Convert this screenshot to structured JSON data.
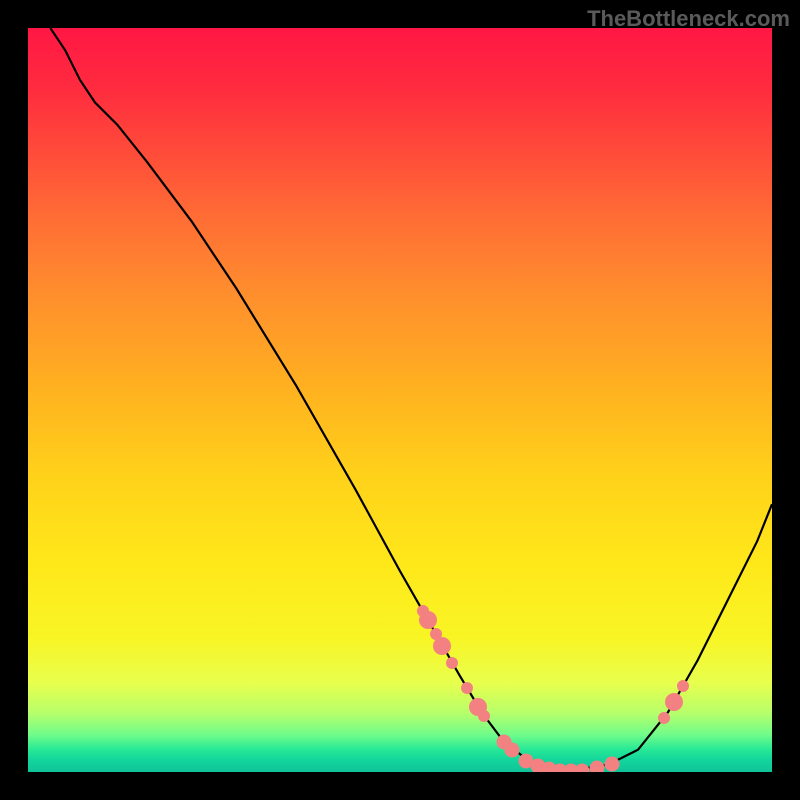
{
  "watermark": "TheBottleneck.com",
  "chart_data": {
    "type": "line",
    "title": "",
    "xlabel": "",
    "ylabel": "",
    "xlim": [
      0,
      100
    ],
    "ylim": [
      0,
      100
    ],
    "curve": {
      "x": [
        3,
        5,
        7,
        9,
        12,
        16,
        22,
        28,
        36,
        44,
        50,
        54,
        58,
        61,
        64,
        68,
        73,
        78,
        82,
        86,
        90,
        94,
        98,
        100
      ],
      "y": [
        100,
        97,
        93,
        90,
        87,
        82,
        74,
        65,
        52,
        38,
        27,
        20,
        13,
        8,
        4,
        1,
        0.2,
        1,
        3,
        8,
        15,
        23,
        31,
        36
      ]
    },
    "markers_on_curve": [
      {
        "x": 53.1,
        "y": 21.6,
        "r": 6
      },
      {
        "x": 53.8,
        "y": 20.4,
        "r": 9
      },
      {
        "x": 54.8,
        "y": 18.6,
        "r": 6
      },
      {
        "x": 55.7,
        "y": 17.0,
        "r": 9
      },
      {
        "x": 57.0,
        "y": 14.7,
        "r": 6
      },
      {
        "x": 59.0,
        "y": 11.3,
        "r": 6
      },
      {
        "x": 60.5,
        "y": 8.8,
        "r": 9
      },
      {
        "x": 61.3,
        "y": 7.5,
        "r": 6
      },
      {
        "x": 64.0,
        "y": 4.0,
        "r": 7.5
      },
      {
        "x": 65.0,
        "y": 3.0,
        "r": 7.5
      },
      {
        "x": 67.0,
        "y": 1.5,
        "r": 7.5
      },
      {
        "x": 68.5,
        "y": 0.8,
        "r": 7.5
      },
      {
        "x": 70.0,
        "y": 0.4,
        "r": 7.5
      },
      {
        "x": 71.5,
        "y": 0.2,
        "r": 7.5
      },
      {
        "x": 73.0,
        "y": 0.15,
        "r": 7.5
      },
      {
        "x": 74.5,
        "y": 0.2,
        "r": 7.5
      },
      {
        "x": 76.5,
        "y": 0.5,
        "r": 7.5
      },
      {
        "x": 78.5,
        "y": 1.1,
        "r": 7.5
      },
      {
        "x": 85.5,
        "y": 7.2,
        "r": 6
      },
      {
        "x": 86.8,
        "y": 9.4,
        "r": 9
      },
      {
        "x": 88.0,
        "y": 11.5,
        "r": 6
      }
    ],
    "gradient_stops": [
      {
        "pct": 0,
        "color": "#ff1744"
      },
      {
        "pct": 25,
        "color": "#ff6b35"
      },
      {
        "pct": 60,
        "color": "#ffd11a"
      },
      {
        "pct": 88,
        "color": "#e8ff4d"
      },
      {
        "pct": 97,
        "color": "#26e896"
      },
      {
        "pct": 100,
        "color": "#10c299"
      }
    ]
  }
}
